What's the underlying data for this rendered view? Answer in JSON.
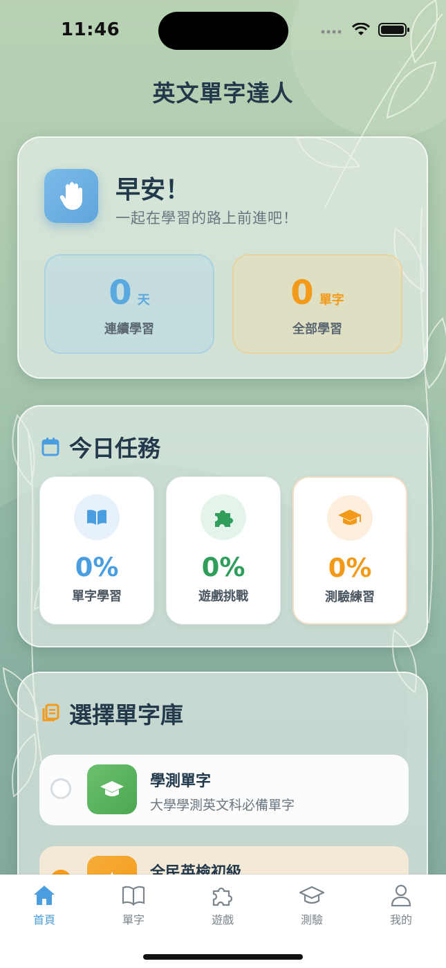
{
  "status_bar": {
    "time": "11:46"
  },
  "app_title": "英文單字達人",
  "greeting": {
    "icon": "hand-icon",
    "title": "早安！",
    "subtitle": "一起在學習的路上前進吧！",
    "stats": [
      {
        "value": "0",
        "unit": "天",
        "label": "連續學習",
        "color": "#5aa8e0"
      },
      {
        "value": "0",
        "unit": "單字",
        "label": "全部學習",
        "color": "#f39a18"
      }
    ]
  },
  "tasks": {
    "title": "今日任務",
    "icon": "calendar-icon",
    "items": [
      {
        "icon": "book-icon",
        "percent": "0%",
        "label": "單字學習",
        "color": "#4a9ee0"
      },
      {
        "icon": "puzzle-icon",
        "percent": "0%",
        "label": "遊戲挑戰",
        "color": "#2e9e5a"
      },
      {
        "icon": "graduation-cap-icon",
        "percent": "0%",
        "label": "測驗練習",
        "color": "#f39a18"
      }
    ]
  },
  "library": {
    "title": "選擇單字庫",
    "icon": "library-icon",
    "items": [
      {
        "name": "學測單字",
        "description": "大學學測英文科必備單字",
        "icon": "graduation-cap-icon",
        "selected": false,
        "color": "#5cb85c"
      },
      {
        "name": "全民英檢初級",
        "description": "",
        "icon": "star-icon",
        "selected": true,
        "color": "#f39a18"
      }
    ]
  },
  "tab_bar": {
    "items": [
      {
        "label": "首頁",
        "icon": "home-icon",
        "active": true
      },
      {
        "label": "單字",
        "icon": "book-icon",
        "active": false
      },
      {
        "label": "遊戲",
        "icon": "puzzle-icon",
        "active": false
      },
      {
        "label": "測驗",
        "icon": "graduation-cap-icon",
        "active": false
      },
      {
        "label": "我的",
        "icon": "person-icon",
        "active": false
      }
    ]
  }
}
